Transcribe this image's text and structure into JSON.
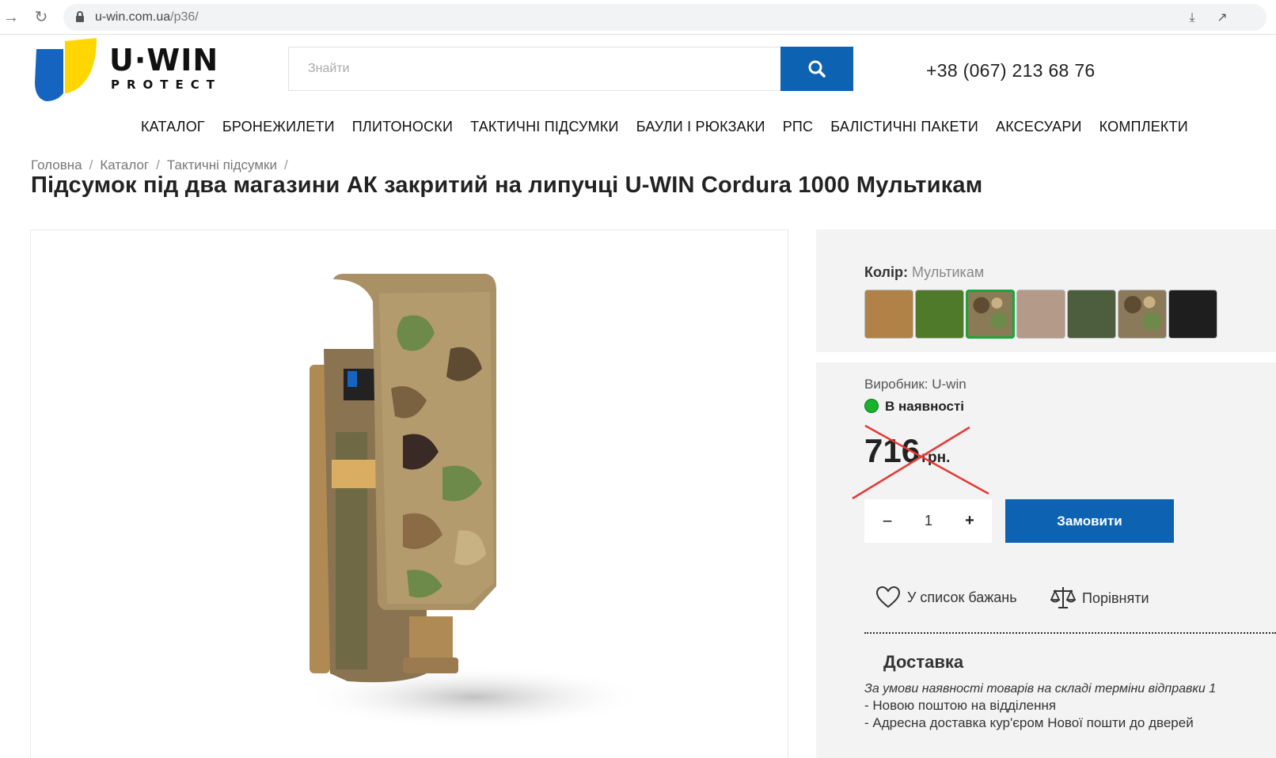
{
  "browser": {
    "url_domain": "u-win.com.ua",
    "url_path": "/p36/"
  },
  "header": {
    "logo_word": "U·WIN",
    "logo_sub": "PROTECT",
    "search_placeholder": "Знайти",
    "phone": "+38 (067) 213 68 76"
  },
  "nav": [
    "КАТАЛОГ",
    "БРОНЕЖИЛЕТИ",
    "ПЛИТОНОСКИ",
    "ТАКТИЧНІ ПІДСУМКИ",
    "БАУЛИ І РЮКЗАКИ",
    "РПС",
    "БАЛІСТИЧНІ ПАКЕТИ",
    "АКСЕСУАРИ",
    "КОМПЛЕКТИ"
  ],
  "breadcrumb": [
    "Головна",
    "Каталог",
    "Тактичні підсумки"
  ],
  "product": {
    "title": "Підсумок під два магазини АК закритий на липучці U-WIN Cordura 1000 Мультикам",
    "color_label": "Колір:",
    "color_value": "Мультикам",
    "swatches": [
      {
        "name": "coyote",
        "color": "#b08248"
      },
      {
        "name": "olive-green",
        "color": "#4f7a2a"
      },
      {
        "name": "multicam",
        "color": "#8a7a55",
        "active": true
      },
      {
        "name": "tan",
        "color": "#b49a88"
      },
      {
        "name": "ranger-green",
        "color": "#4d5e3e"
      },
      {
        "name": "pixel",
        "color": "#8a7a5a"
      },
      {
        "name": "black",
        "color": "#1e1e1e"
      }
    ],
    "maker": "Виробник: U-win",
    "stock": "В наявності",
    "price_amount": "716",
    "price_currency": "грн.",
    "quantity": "1",
    "qty_minus": "−",
    "qty_plus": "+",
    "order_button": "Замовити",
    "wishlist": "У список бажань",
    "compare": "Порівняти"
  },
  "delivery": {
    "title": "Доставка",
    "note": "За умови наявності товарів на складі терміни відправки 1",
    "items": [
      "- Новою поштою на відділення",
      "- Адресна доставка кур'єром Нової пошти до дверей"
    ]
  },
  "colors": {
    "accent": "#0d63b2",
    "stock_green": "#18b32a",
    "active_swatch_border": "#18a53b",
    "cross_red": "#e53935"
  }
}
